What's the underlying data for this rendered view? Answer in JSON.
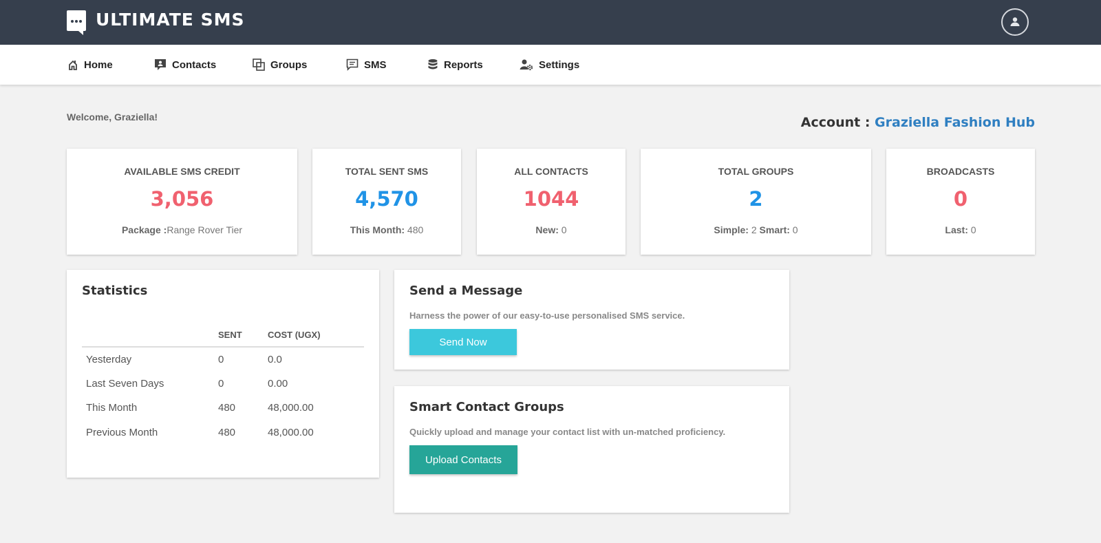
{
  "brand": {
    "name": "ULTIMATE SMS",
    "logo_icon": "chat-bubble-icon"
  },
  "header": {
    "profile_icon": "user-circle-icon"
  },
  "nav": {
    "items": [
      {
        "label": "Home",
        "icon": "home-icon"
      },
      {
        "label": "Contacts",
        "icon": "contact-card-icon"
      },
      {
        "label": "Groups",
        "icon": "groups-icon"
      },
      {
        "label": "SMS",
        "icon": "message-icon"
      },
      {
        "label": "Reports",
        "icon": "database-icon"
      },
      {
        "label": "Settings",
        "icon": "user-gear-icon"
      }
    ]
  },
  "welcome": "Welcome, Graziella!",
  "account": {
    "label": "Account : ",
    "name": "Graziella Fashion Hub"
  },
  "stats": [
    {
      "label": "AVAILABLE SMS CREDIT",
      "value": "3,056",
      "sub_label": "Package :",
      "sub_value": "Range Rover Tier",
      "color": "#f0616f"
    },
    {
      "label": "TOTAL SENT SMS",
      "value": "4,570",
      "sub_label": "This Month:",
      "sub_value": " 480",
      "color": "#2093e6"
    },
    {
      "label": "ALL CONTACTS",
      "value": "1044",
      "sub_label": "New:",
      "sub_value": " 0",
      "color": "#f0616f"
    },
    {
      "label": "TOTAL GROUPS",
      "value": "2",
      "sub_label": "Simple:",
      "sub_value": " 2 ",
      "sub_label2": "Smart:",
      "sub_value2": " 0",
      "color": "#2093e6"
    },
    {
      "label": "BROADCASTS",
      "value": "0",
      "sub_label": "Last:",
      "sub_value": " 0",
      "color": "#f0616f"
    }
  ],
  "statistics": {
    "title": "Statistics",
    "columns": [
      "",
      "SENT",
      "COST (UGX)"
    ],
    "rows": [
      [
        "Yesterday",
        "0",
        "0.0"
      ],
      [
        "Last Seven Days",
        "0",
        "0.00"
      ],
      [
        "This Month",
        "480",
        "48,000.00"
      ],
      [
        "Previous Month",
        "480",
        "48,000.00"
      ]
    ]
  },
  "send_message": {
    "title": "Send a Message",
    "description": "Harness the power of our easy-to-use personalised SMS service.",
    "button": "Send Now"
  },
  "smart_groups": {
    "title": "Smart Contact Groups",
    "description": "Quickly upload and manage your contact list with un-matched proficiency.",
    "button": "Upload Contacts"
  }
}
